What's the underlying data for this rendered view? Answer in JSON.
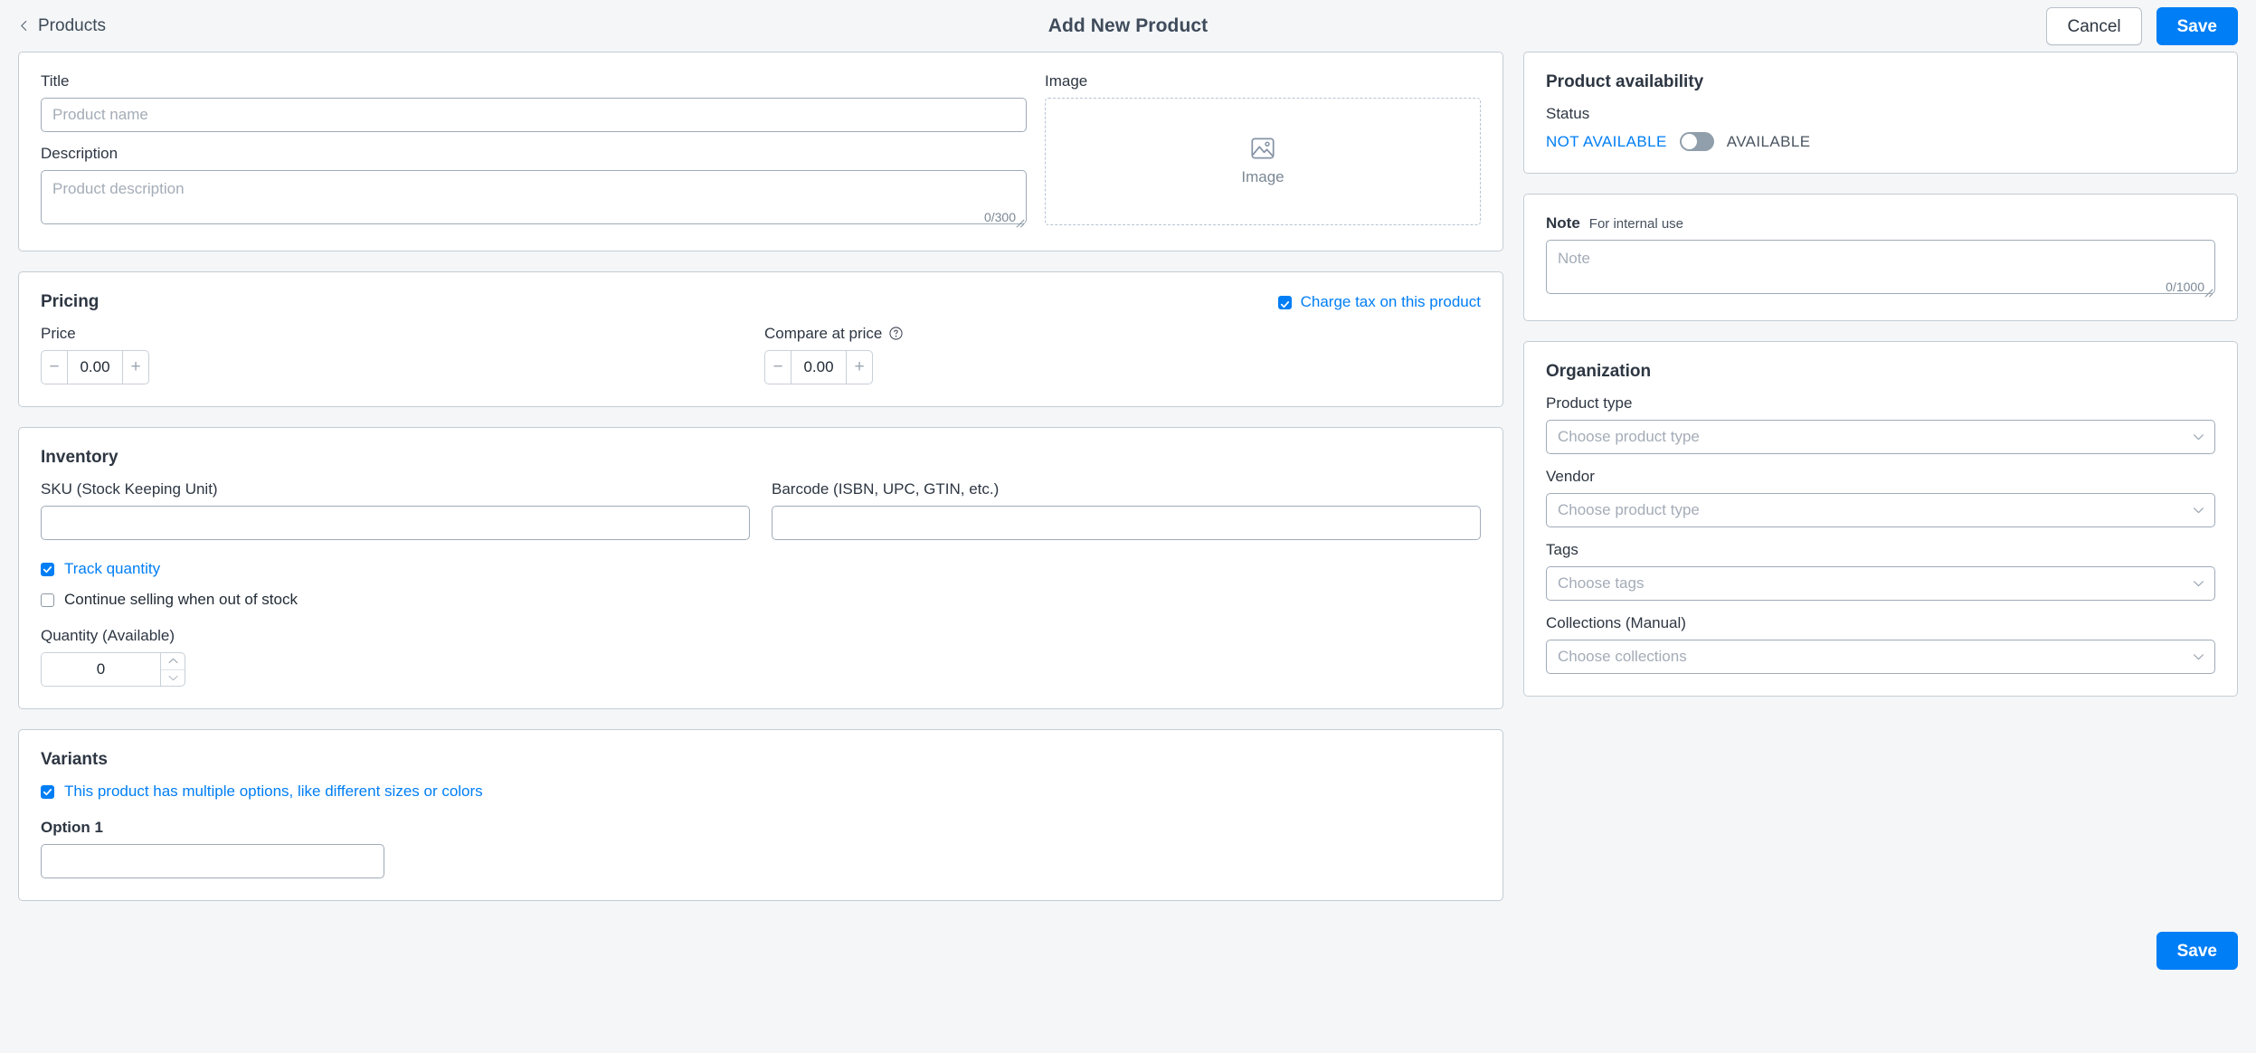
{
  "topbar": {
    "back_label": "Products",
    "title": "Add New Product",
    "cancel_label": "Cancel",
    "save_label": "Save"
  },
  "details": {
    "title_label": "Title",
    "title_value": "",
    "title_placeholder": "Product name",
    "description_label": "Description",
    "description_value": "",
    "description_placeholder": "Product description",
    "description_counter": "0/300",
    "image_label": "Image",
    "image_dropzone_label": "Image"
  },
  "pricing": {
    "section_title": "Pricing",
    "charge_tax_label": "Charge tax on this product",
    "charge_tax_checked": true,
    "price_label": "Price",
    "price_value": "0.00",
    "compare_label": "Compare at price",
    "compare_value": "0.00",
    "decrement_symbol": "−",
    "increment_symbol": "+"
  },
  "inventory": {
    "section_title": "Inventory",
    "sku_label": "SKU (Stock Keeping Unit)",
    "sku_value": "",
    "barcode_label": "Barcode (ISBN, UPC, GTIN, etc.)",
    "barcode_value": "",
    "track_quantity_label": "Track quantity",
    "track_quantity_checked": true,
    "continue_selling_label": "Continue selling when out of stock",
    "continue_selling_checked": false,
    "quantity_label": "Quantity (Available)",
    "quantity_value": "0"
  },
  "variants": {
    "section_title": "Variants",
    "multiple_options_label": "This product has multiple options, like different sizes or colors",
    "multiple_options_checked": true,
    "option1_label": "Option 1",
    "option1_value": ""
  },
  "availability": {
    "section_title": "Product availability",
    "status_label": "Status",
    "status_off_label": "NOT AVAILABLE",
    "status_on_label": "AVAILABLE",
    "status_value": "NOT AVAILABLE"
  },
  "note": {
    "label": "Note",
    "sub_label": "For internal use",
    "value": "",
    "placeholder": "Note",
    "counter": "0/1000"
  },
  "organization": {
    "section_title": "Organization",
    "product_type_label": "Product type",
    "product_type_placeholder": "Choose product type",
    "vendor_label": "Vendor",
    "vendor_placeholder": "Choose product type",
    "tags_label": "Tags",
    "tags_placeholder": "Choose tags",
    "collections_label": "Collections (Manual)",
    "collections_placeholder": "Choose collections"
  },
  "footer": {
    "save_label": "Save"
  },
  "colors": {
    "accent": "#007ef5",
    "page_bg": "#f4f6f8",
    "card_border": "#c4cdd5",
    "text": "#212b36",
    "muted": "#7b8794"
  }
}
